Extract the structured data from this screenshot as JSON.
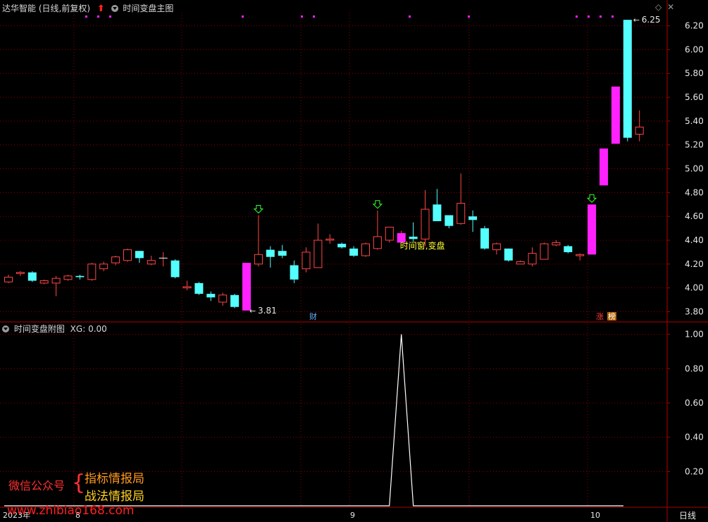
{
  "header": {
    "title": "达华智能",
    "period": "(日线,前复权)",
    "main_indicator": "时间变盘主图",
    "sub_indicator": "时间变盘附图",
    "xg_label": "XG:",
    "xg_value": "0.00"
  },
  "footer": {
    "period_button": "日线"
  },
  "watermark": {
    "wechat_label": "微信公众号",
    "brace": "{",
    "line1": "指标情报局",
    "line2": "战法情报局",
    "url": "www.zhibiao168.com"
  },
  "colors": {
    "up": "#ff4545",
    "down": "#54ffff",
    "signal": "#ff22ff",
    "grid": "#8b0000",
    "axis_text": "#e8e8e8",
    "annotation": "#ffff33",
    "arrow": "#33ff33"
  },
  "chart_data": [
    {
      "type": "candlestick",
      "title": "时间变盘主图",
      "ylim": [
        3.72,
        6.31
      ],
      "y_ticks": [
        "6.20",
        "6.00",
        "5.80",
        "5.60",
        "5.40",
        "5.20",
        "5.00",
        "4.80",
        "4.60",
        "4.40",
        "4.20",
        "4.00",
        "3.80"
      ],
      "x_labels": [
        "2023年",
        "8",
        "9",
        "10"
      ],
      "candles": [
        {
          "o": 4.05,
          "h": 4.11,
          "l": 4.04,
          "c": 4.09
        },
        {
          "o": 4.12,
          "h": 4.14,
          "l": 4.1,
          "c": 4.13
        },
        {
          "o": 4.13,
          "h": 4.14,
          "l": 4.05,
          "c": 4.06
        },
        {
          "o": 4.04,
          "h": 4.07,
          "l": 4.03,
          "c": 4.06
        },
        {
          "o": 4.04,
          "h": 4.1,
          "l": 3.93,
          "c": 4.08
        },
        {
          "o": 4.07,
          "h": 4.11,
          "l": 4.06,
          "c": 4.1
        },
        {
          "o": 4.1,
          "h": 4.11,
          "l": 4.07,
          "c": 4.09
        },
        {
          "o": 4.07,
          "h": 4.21,
          "l": 4.06,
          "c": 4.2
        },
        {
          "o": 4.16,
          "h": 4.22,
          "l": 4.14,
          "c": 4.2
        },
        {
          "o": 4.21,
          "h": 4.27,
          "l": 4.19,
          "c": 4.26
        },
        {
          "o": 4.23,
          "h": 4.33,
          "l": 4.22,
          "c": 4.32
        },
        {
          "o": 4.31,
          "h": 4.31,
          "l": 4.21,
          "c": 4.25
        },
        {
          "o": 4.2,
          "h": 4.27,
          "l": 4.19,
          "c": 4.23
        },
        {
          "o": 4.25,
          "h": 4.3,
          "l": 4.18,
          "c": 4.25
        },
        {
          "o": 4.23,
          "h": 4.24,
          "l": 4.08,
          "c": 4.09
        },
        {
          "o": 4.0,
          "h": 4.06,
          "l": 3.98,
          "c": 4.01
        },
        {
          "o": 4.04,
          "h": 4.05,
          "l": 3.94,
          "c": 3.95
        },
        {
          "o": 3.95,
          "h": 3.97,
          "l": 3.89,
          "c": 3.92
        },
        {
          "o": 3.88,
          "h": 3.96,
          "l": 3.85,
          "c": 3.94
        },
        {
          "o": 3.94,
          "h": 3.95,
          "l": 3.83,
          "c": 3.84
        },
        {
          "o": 3.81,
          "h": 4.21,
          "l": 3.81,
          "c": 4.21,
          "signal": true
        },
        {
          "o": 4.2,
          "h": 4.61,
          "l": 4.18,
          "c": 4.28
        },
        {
          "o": 4.32,
          "h": 4.35,
          "l": 4.17,
          "c": 4.26
        },
        {
          "o": 4.31,
          "h": 4.36,
          "l": 4.25,
          "c": 4.27
        },
        {
          "o": 4.19,
          "h": 4.23,
          "l": 4.04,
          "c": 4.07
        },
        {
          "o": 4.16,
          "h": 4.34,
          "l": 4.13,
          "c": 4.3
        },
        {
          "o": 4.17,
          "h": 4.54,
          "l": 4.17,
          "c": 4.4
        },
        {
          "o": 4.4,
          "h": 4.45,
          "l": 4.37,
          "c": 4.41
        },
        {
          "o": 4.37,
          "h": 4.38,
          "l": 4.33,
          "c": 4.34
        },
        {
          "o": 4.33,
          "h": 4.35,
          "l": 4.26,
          "c": 4.27
        },
        {
          "o": 4.27,
          "h": 4.38,
          "l": 4.26,
          "c": 4.37
        },
        {
          "o": 4.33,
          "h": 4.65,
          "l": 4.32,
          "c": 4.43
        },
        {
          "o": 4.4,
          "h": 4.51,
          "l": 4.38,
          "c": 4.51
        },
        {
          "o": 4.46,
          "h": 4.48,
          "l": 4.38,
          "c": 4.38,
          "signal": true
        },
        {
          "o": 4.43,
          "h": 4.55,
          "l": 4.39,
          "c": 4.41
        },
        {
          "o": 4.41,
          "h": 4.82,
          "l": 4.35,
          "c": 4.66
        },
        {
          "o": 4.7,
          "h": 4.83,
          "l": 4.59,
          "c": 4.56
        },
        {
          "o": 4.61,
          "h": 4.61,
          "l": 4.5,
          "c": 4.52
        },
        {
          "o": 4.54,
          "h": 4.96,
          "l": 4.53,
          "c": 4.71
        },
        {
          "o": 4.6,
          "h": 4.65,
          "l": 4.47,
          "c": 4.57
        },
        {
          "o": 4.5,
          "h": 4.52,
          "l": 4.32,
          "c": 4.33
        },
        {
          "o": 4.32,
          "h": 4.38,
          "l": 4.28,
          "c": 4.37
        },
        {
          "o": 4.33,
          "h": 4.33,
          "l": 4.22,
          "c": 4.23
        },
        {
          "o": 4.2,
          "h": 4.23,
          "l": 4.2,
          "c": 4.22
        },
        {
          "o": 4.2,
          "h": 4.34,
          "l": 4.18,
          "c": 4.29
        },
        {
          "o": 4.24,
          "h": 4.38,
          "l": 4.24,
          "c": 4.37
        },
        {
          "o": 4.36,
          "h": 4.4,
          "l": 4.35,
          "c": 4.38
        },
        {
          "o": 4.35,
          "h": 4.36,
          "l": 4.29,
          "c": 4.3
        },
        {
          "o": 4.27,
          "h": 4.29,
          "l": 4.23,
          "c": 4.28
        },
        {
          "o": 4.28,
          "h": 4.7,
          "l": 4.28,
          "c": 4.7,
          "signal": true
        },
        {
          "o": 4.86,
          "h": 5.17,
          "l": 4.86,
          "c": 5.17,
          "signal": true
        },
        {
          "o": 5.21,
          "h": 5.69,
          "l": 5.21,
          "c": 5.69,
          "signal": true
        },
        {
          "o": 6.25,
          "h": 6.25,
          "l": 5.23,
          "c": 5.26
        },
        {
          "o": 5.29,
          "h": 5.49,
          "l": 5.23,
          "c": 5.35
        }
      ],
      "annotations": {
        "high_label": "6.25",
        "low_label": "3.81",
        "window_label": "时间窗,变盘",
        "finance_badge": "财",
        "limit_badge": "涨",
        "rank_badge": "榜"
      }
    },
    {
      "type": "line",
      "title": "时间变盘附图",
      "ylim": [
        0,
        1.06
      ],
      "y_ticks": [
        "1.00",
        "0.80",
        "0.60",
        "0.40",
        "0.20"
      ],
      "series": [
        {
          "name": "XG",
          "peak_index": 33,
          "values_note_only": ""
        }
      ]
    }
  ]
}
